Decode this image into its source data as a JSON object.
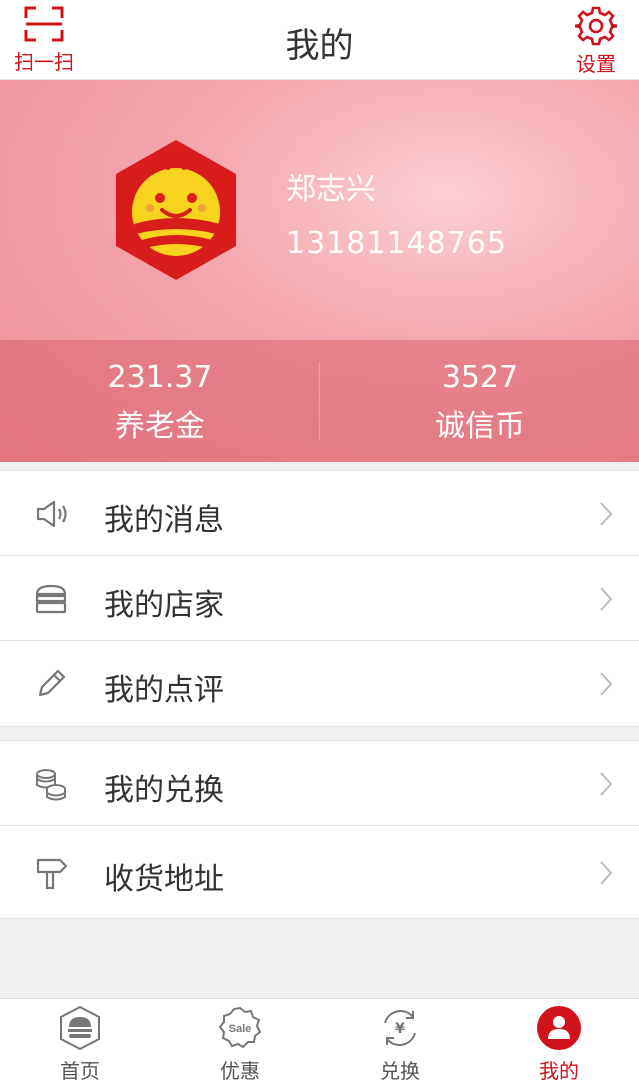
{
  "header": {
    "title": "我的",
    "scan_label": "扫一扫",
    "settings_label": "设置"
  },
  "profile": {
    "name": "郑志兴",
    "phone": "13181148765",
    "stats": [
      {
        "value": "231.37",
        "label": "养老金"
      },
      {
        "value": "3527",
        "label": "诚信币"
      }
    ]
  },
  "menu_groups": [
    {
      "items": [
        {
          "label": "我的消息",
          "icon": "speaker-icon"
        },
        {
          "label": "我的店家",
          "icon": "store-icon"
        },
        {
          "label": "我的点评",
          "icon": "pencil-icon"
        }
      ]
    },
    {
      "items": [
        {
          "label": "我的兑换",
          "icon": "coins-icon"
        },
        {
          "label": "收货地址",
          "icon": "signpost-icon"
        }
      ]
    }
  ],
  "tabbar": {
    "tabs": [
      {
        "label": "首页",
        "icon": "burger-home-icon"
      },
      {
        "label": "优惠",
        "icon": "sale-badge-icon"
      },
      {
        "label": "兑换",
        "icon": "yuan-exchange-icon"
      },
      {
        "label": "我的",
        "icon": "user-profile-icon"
      }
    ],
    "active_index": 3
  },
  "colors": {
    "accent": "#d0121b",
    "banner": "#f5a6ae"
  }
}
